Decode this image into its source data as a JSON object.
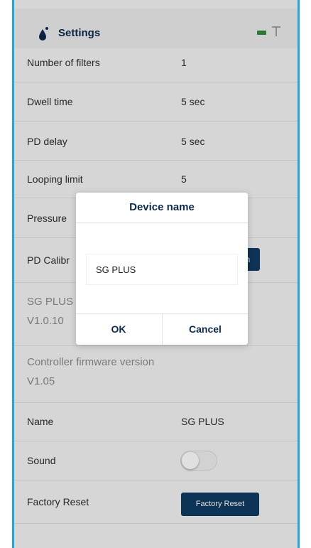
{
  "header": {
    "title": "Settings",
    "icons": [
      "water-drop-icon",
      "battery-icon",
      "antenna-icon"
    ]
  },
  "settings": {
    "number_of_filters": {
      "label": "Number of filters",
      "value": "1"
    },
    "dwell_time": {
      "label": "Dwell time",
      "value": "5 sec"
    },
    "pd_delay": {
      "label": "PD delay",
      "value": "5 sec"
    },
    "looping_limit": {
      "label": "Looping limit",
      "value": "5"
    },
    "pressure": {
      "label": "Pressure"
    },
    "pd_calibration": {
      "label": "PD Calibr",
      "button_fragment": "n"
    },
    "sg_plus_version": {
      "label": "SG PLUS",
      "value": "V1.0.10"
    },
    "controller_firmware": {
      "label": "Controller firmware version",
      "value": "V1.05"
    },
    "name": {
      "label": "Name",
      "value": "SG PLUS"
    },
    "sound": {
      "label": "Sound",
      "enabled": false
    },
    "factory_reset": {
      "label": "Factory Reset",
      "button_label": "Factory Reset"
    }
  },
  "dialog": {
    "title": "Device name",
    "input_value": "SG PLUS",
    "ok_label": "OK",
    "cancel_label": "Cancel"
  },
  "colors": {
    "accent": "#1da6df",
    "primary_dark": "#0f3b63",
    "battery": "#2e8b3d"
  }
}
